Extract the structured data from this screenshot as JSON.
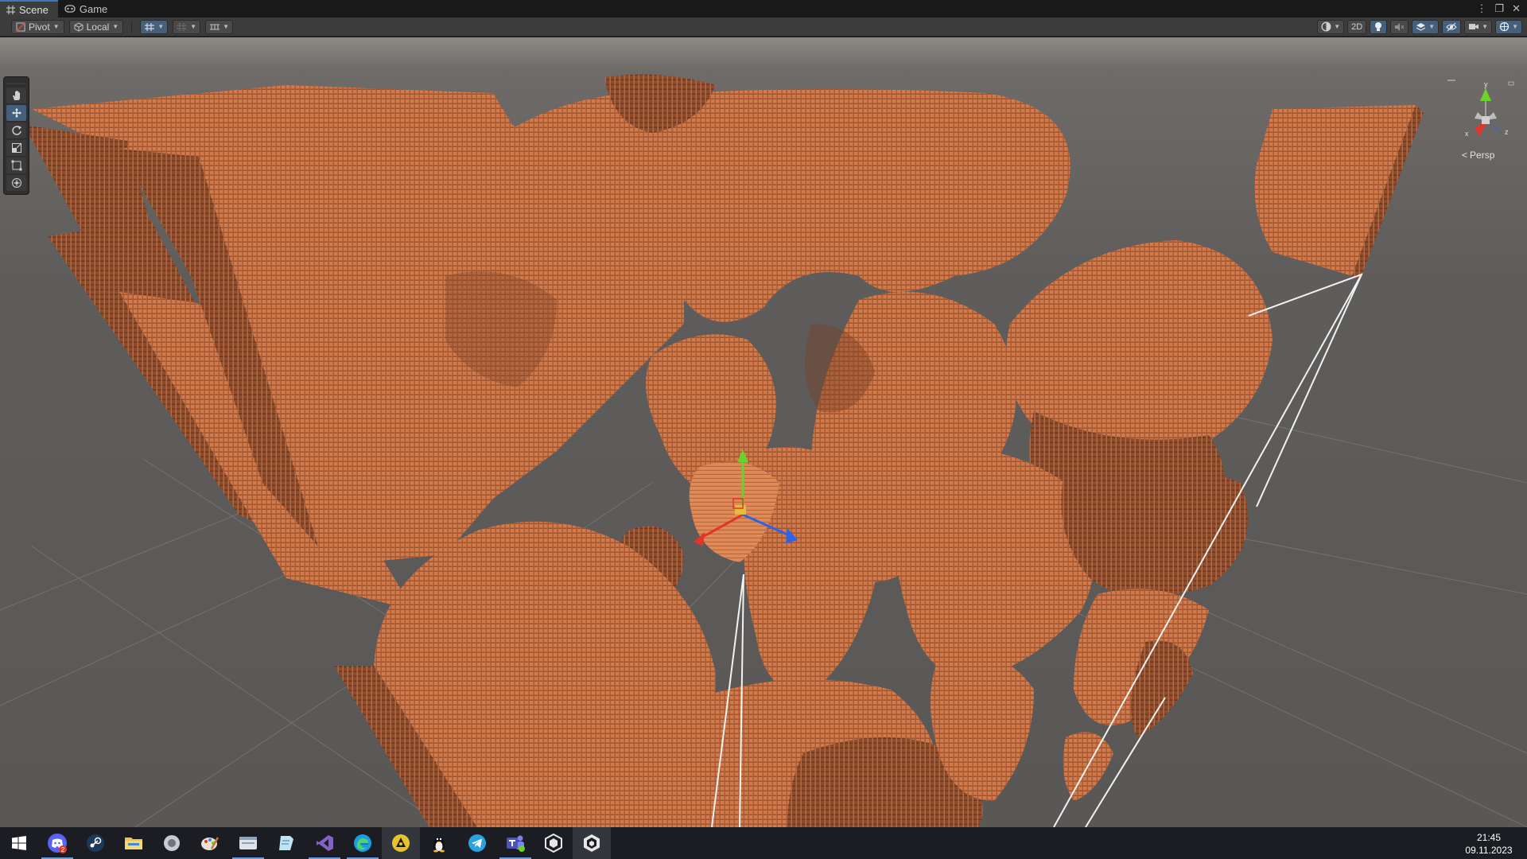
{
  "window": {
    "tabs": [
      {
        "label": "Scene",
        "icon": "grid-icon",
        "active": true
      },
      {
        "label": "Game",
        "icon": "gamepad-icon",
        "active": false
      }
    ]
  },
  "toolbar": {
    "pivot_label": "Pivot",
    "local_label": "Local",
    "twod_label": "2D"
  },
  "scene": {
    "projection_label": "Persp",
    "gizmo_axes": {
      "x": "x",
      "y": "y",
      "z": "z"
    },
    "colors": {
      "terrain": "#d5794a",
      "terrain_dark": "#7a4326",
      "background": "#5f5d5b",
      "grid": "#7c7b7a",
      "axis_x": "#e0352b",
      "axis_y": "#69d22c",
      "axis_z": "#2f62e6"
    }
  },
  "taskbar": {
    "apps": [
      "windows-start-icon",
      "discord-icon",
      "steam-icon",
      "file-explorer-icon",
      "app-icon",
      "paint-icon",
      "app-window-icon",
      "notes-icon",
      "visual-studio-icon",
      "edge-icon",
      "app-icon",
      "linux-icon",
      "telegram-icon",
      "teams-icon",
      "unity-hub-icon",
      "unity-icon"
    ],
    "discord_badge": "2",
    "time": "21:45",
    "date": "09.11.2023"
  }
}
